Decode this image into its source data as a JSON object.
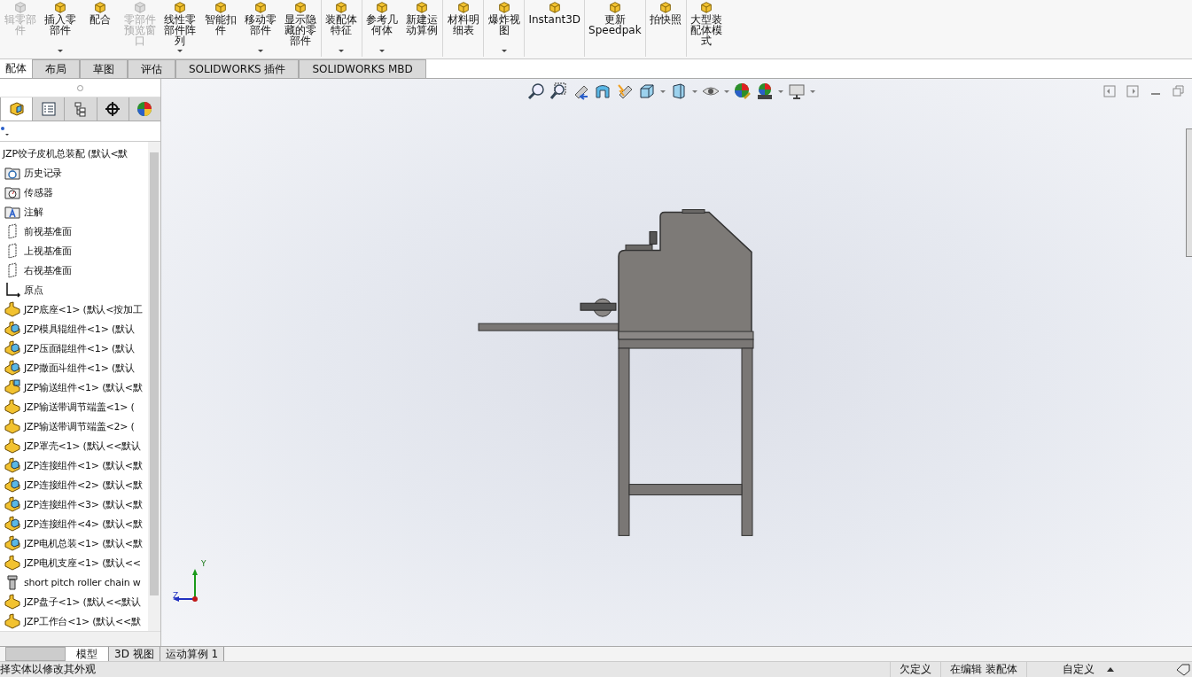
{
  "ribbon": [
    {
      "label": "辑零部件",
      "disabled": true,
      "dropdown": false,
      "separated": false
    },
    {
      "label": "插入零部件",
      "disabled": false,
      "dropdown": true,
      "separated": false
    },
    {
      "label": "配合",
      "disabled": false,
      "dropdown": false,
      "separated": false
    },
    {
      "label": "零部件预览窗口",
      "disabled": true,
      "dropdown": false,
      "separated": false
    },
    {
      "label": "线性零部件阵列",
      "disabled": false,
      "dropdown": true,
      "separated": false
    },
    {
      "label": "智能扣件",
      "disabled": false,
      "dropdown": false,
      "separated": false
    },
    {
      "label": "移动零部件",
      "disabled": false,
      "dropdown": true,
      "separated": false
    },
    {
      "label": "显示隐藏的零部件",
      "disabled": false,
      "dropdown": false,
      "separated": true
    },
    {
      "label": "装配体特征",
      "disabled": false,
      "dropdown": true,
      "separated": true
    },
    {
      "label": "参考几何体",
      "disabled": false,
      "dropdown": true,
      "separated": false
    },
    {
      "label": "新建运动算例",
      "disabled": false,
      "dropdown": false,
      "separated": true
    },
    {
      "label": "材料明细表",
      "disabled": false,
      "dropdown": false,
      "separated": true
    },
    {
      "label": "爆炸视图",
      "disabled": false,
      "dropdown": true,
      "separated": true
    },
    {
      "label": "Instant3D",
      "disabled": false,
      "dropdown": false,
      "separated": true
    },
    {
      "label": "更新 Speedpak",
      "disabled": false,
      "dropdown": false,
      "separated": true
    },
    {
      "label": "拍快照",
      "disabled": false,
      "dropdown": false,
      "separated": true
    },
    {
      "label": "大型装配体模式",
      "disabled": false,
      "dropdown": false,
      "separated": false
    }
  ],
  "tabs": [
    {
      "label": "配体",
      "selected": true
    },
    {
      "label": "布局",
      "selected": false
    },
    {
      "label": "草图",
      "selected": false
    },
    {
      "label": "评估",
      "selected": false
    },
    {
      "label": "SOLIDWORKS 插件",
      "selected": false
    },
    {
      "label": "SOLIDWORKS MBD",
      "selected": false
    }
  ],
  "panel_tabs": [
    {
      "kind": "feature-tree",
      "selected": true
    },
    {
      "kind": "property",
      "selected": false
    },
    {
      "kind": "configuration",
      "selected": false
    },
    {
      "kind": "target",
      "selected": false
    },
    {
      "kind": "appearance",
      "selected": false
    }
  ],
  "tree": {
    "label": "JZP饺子皮机总装配 (默认<默",
    "children": [
      {
        "kind": "history",
        "label": "历史记录"
      },
      {
        "kind": "sensor",
        "label": "传感器"
      },
      {
        "kind": "annotation",
        "label": "注解"
      },
      {
        "kind": "plane",
        "label": "前视基准面"
      },
      {
        "kind": "plane",
        "label": "上视基准面"
      },
      {
        "kind": "plane",
        "label": "右视基准面"
      },
      {
        "kind": "origin",
        "label": "原点"
      },
      {
        "kind": "part",
        "label": "JZP底座<1> (默认<按加工"
      },
      {
        "kind": "assembly",
        "label": "JZP模具辊组件<1> (默认"
      },
      {
        "kind": "assembly",
        "label": "JZP压面辊组件<1> (默认"
      },
      {
        "kind": "assembly",
        "label": "JZP撒面斗组件<1> (默认"
      },
      {
        "kind": "flexible",
        "label": "JZP输送组件<1> (默认<默"
      },
      {
        "kind": "part",
        "label": "JZP输送带调节端盖<1> ("
      },
      {
        "kind": "part",
        "label": "JZP输送带调节端盖<2> ("
      },
      {
        "kind": "part",
        "label": "JZP罩壳<1> (默认<<默认"
      },
      {
        "kind": "assembly",
        "label": "JZP连接组件<1> (默认<默"
      },
      {
        "kind": "assembly",
        "label": "JZP连接组件<2> (默认<默"
      },
      {
        "kind": "assembly",
        "label": "JZP连接组件<3> (默认<默"
      },
      {
        "kind": "assembly",
        "label": "JZP连接组件<4> (默认<默"
      },
      {
        "kind": "assembly",
        "label": "JZP电机总装<1> (默认<默"
      },
      {
        "kind": "part",
        "label": "JZP电机支座<1> (默认<<"
      },
      {
        "kind": "fastener",
        "label": "short pitch roller chain w"
      },
      {
        "kind": "part",
        "label": "JZP盘子<1> (默认<<默认"
      },
      {
        "kind": "part",
        "label": "JZP工作台<1> (默认<<默"
      }
    ]
  },
  "triad": {
    "y_label": "Y",
    "z_label": "Z"
  },
  "bottom_tabs": [
    {
      "label": "模型",
      "selected": true
    },
    {
      "label": "3D 视图",
      "selected": false
    },
    {
      "label": "运动算例 1",
      "selected": false
    }
  ],
  "status_bar": {
    "message": "择实体以修改其外观",
    "fields": [
      "欠定义",
      "在编辑 装配体",
      "自定义"
    ]
  }
}
